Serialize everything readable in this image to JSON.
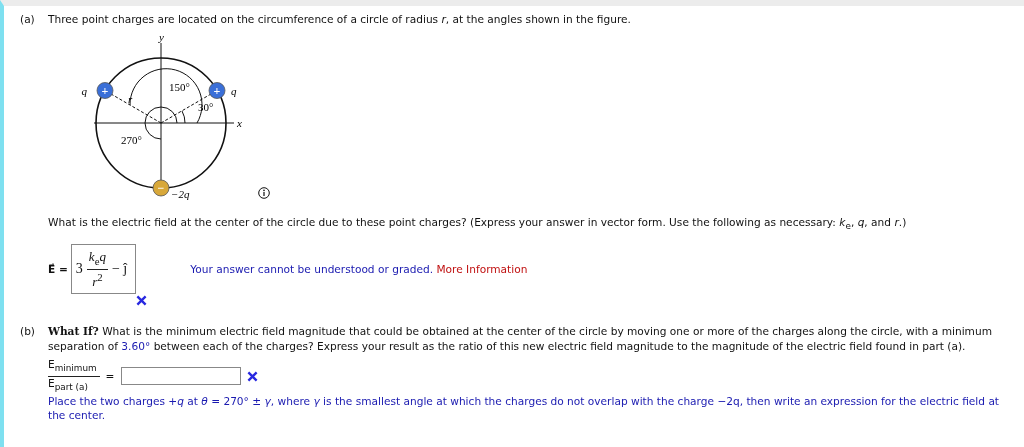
{
  "part_a": {
    "label": "(a)",
    "intro": "Three point charges are located on the circumference of a circle of radius *r*, at the angles shown in the figure.",
    "figure": {
      "axis_x": "x",
      "axis_y": "y",
      "radius": "r",
      "angles": [
        "150°",
        "30°",
        "270°"
      ],
      "charges": [
        {
          "kind": "positive",
          "sign": "+",
          "label": "q"
        },
        {
          "kind": "positive",
          "sign": "+",
          "label": "q"
        },
        {
          "kind": "negative",
          "sign": "−",
          "label": "−2q"
        }
      ]
    },
    "question": "What is the electric field at the center of the circle due to these point charges? (Express your answer in vector form. Use the following as necessary: *k*$_{e}$, *q*, and *r*.)",
    "answer": {
      "symbol": "E⃗",
      "equals": "=",
      "coefficient": "3",
      "numerator": "*k*$_{e}$*q*",
      "denominator": "*r*$^{2}$",
      "rest": "− ĵ",
      "correct": false
    },
    "feedback": "Your answer cannot be understood or graded.",
    "feedback_link": "More Information"
  },
  "part_b": {
    "label": "(b)",
    "lead": "What If?",
    "question_before": "What is the minimum electric field magnitude that could be obtained at the center of the circle by moving one or more of the charges along the circle, with a minimum separation of",
    "separation": "3.60°",
    "question_after": "between each of the charges? Express your result as the ratio of this new electric field magnitude to the magnitude of the electric field found in part (a).",
    "ratio_numerator": "E$_{minimum}$",
    "ratio_denominator": "E$_{part (a)}$",
    "equals": "=",
    "answer": {
      "correct": false
    },
    "hint": "Place the two charges +*q* at *θ* = 270° ± *γ*, where *γ* is the smallest angle at which the charges do not overlap with the charge −2q, then write an expression for the electric field at the center."
  }
}
